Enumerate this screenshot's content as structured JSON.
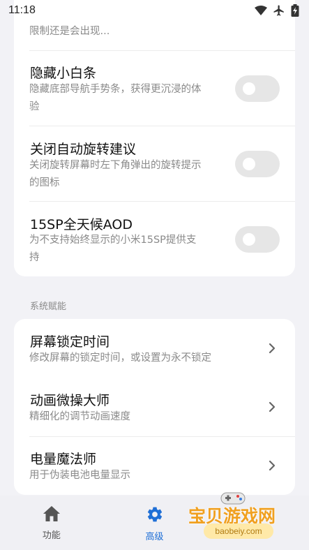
{
  "status_bar": {
    "time": "11:18"
  },
  "top_card": {
    "partial_desc": "限制还是会出现...",
    "items": [
      {
        "title": "隐藏小白条",
        "desc_line1": "隐藏底部导航手势条，获得更沉浸的体",
        "desc_line2": "验",
        "toggle_on": false
      },
      {
        "title": "关闭自动旋转建议",
        "desc_line1": "关闭旋转屏幕时左下角弹出的旋转提示",
        "desc_line2": "的图标",
        "toggle_on": false
      },
      {
        "title": "15SP全天候AOD",
        "desc_line1": "为不支持始终显示的小米15SP提供支",
        "desc_line2": "持",
        "toggle_on": false
      }
    ]
  },
  "section_system": {
    "header": "系统赋能",
    "items": [
      {
        "title": "屏幕锁定时间",
        "desc": "修改屏幕的锁定时间，或设置为永不锁定"
      },
      {
        "title": "动画微操大师",
        "desc": "精细化的调节动画速度"
      },
      {
        "title": "电量魔法师",
        "desc": "用于伪装电池电量显示"
      }
    ]
  },
  "bottom_nav": {
    "items": [
      {
        "label": "功能",
        "icon": "home-icon",
        "active": false
      },
      {
        "label": "高级",
        "icon": "gear-icon",
        "active": true
      }
    ]
  },
  "watermark": {
    "text": "宝贝游戏网",
    "url": "baobeiy.com"
  },
  "colors": {
    "background": "#f2f2f6",
    "card": "#ffffff",
    "accent": "#1f6fd6",
    "toggle_off": "#e6e6e6",
    "secondary_text": "#8a8a8a",
    "watermark": "#f0a020"
  }
}
